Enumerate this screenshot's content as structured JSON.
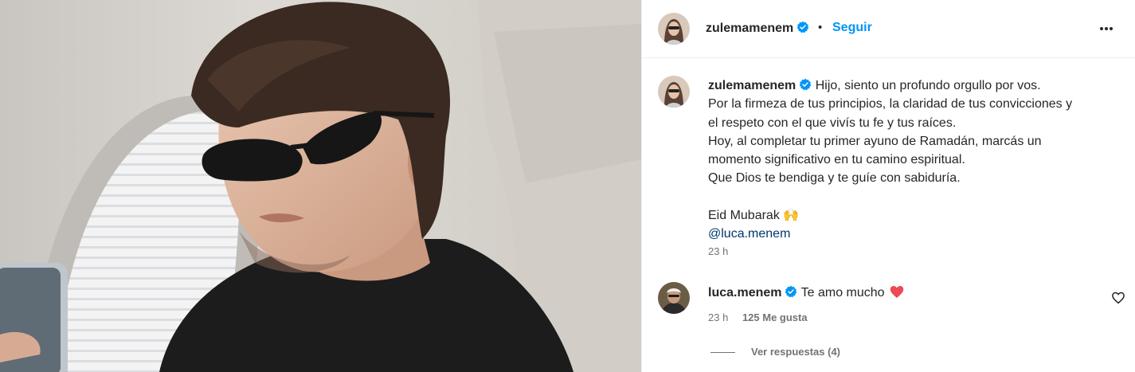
{
  "header": {
    "username": "zulemamenem",
    "separator": "•",
    "follow_label": "Seguir",
    "more_icon": "more-horizontal-icon"
  },
  "caption": {
    "username": "zulemamenem",
    "lines": [
      "Hijo, siento un profundo orgullo por vos.",
      "Por la firmeza de tus principios, la claridad de tus convicciones y",
      "el respeto con el que vivís tu fe y tus raíces.",
      "Hoy, al completar tu primer ayuno de Ramadán, marcás un",
      "momento significativo en tu camino espiritual.",
      "Que Dios te bendiga y te guíe con sabiduría.",
      "Eid Mubarak 🙌",
      "@luca.menem"
    ],
    "time": "23 h"
  },
  "comment": {
    "username": "luca.menem",
    "text": "Te amo mucho",
    "emoji_icon": "red-heart-icon",
    "time": "23 h",
    "likes": "125 Me gusta"
  },
  "replies": {
    "label": "Ver respuestas (4)"
  },
  "colors": {
    "link_blue": "#0095f6",
    "mention": "#00376b",
    "verified": "#0095f6",
    "muted": "#737373"
  }
}
